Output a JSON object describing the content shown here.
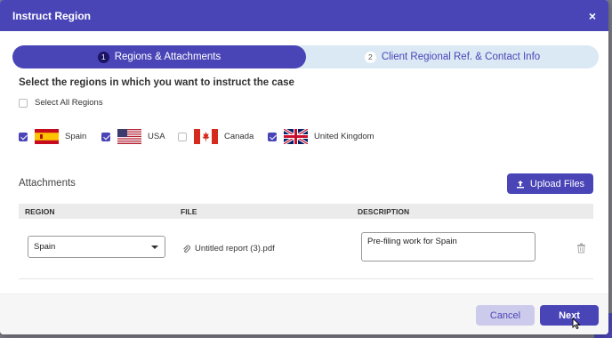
{
  "modal": {
    "title": "Instruct Region",
    "close_symbol": "×"
  },
  "steps": [
    {
      "number": "1",
      "label": "Regions & Attachments",
      "active": true
    },
    {
      "number": "2",
      "label": "Client Regional Ref. & Contact Info",
      "active": false
    }
  ],
  "regions_section": {
    "heading": "Select the regions in which you want to instruct the case",
    "select_all_label": "Select All Regions",
    "select_all_checked": false,
    "regions": [
      {
        "name": "Spain",
        "checked": true,
        "flag": "spain-flag-icon"
      },
      {
        "name": "USA",
        "checked": true,
        "flag": "usa-flag-icon"
      },
      {
        "name": "Canada",
        "checked": false,
        "flag": "canada-flag-icon"
      },
      {
        "name": "United Kingdom",
        "checked": true,
        "flag": "uk-flag-icon"
      }
    ]
  },
  "attachments": {
    "label": "Attachments",
    "upload_label": "Upload Files",
    "columns": [
      "REGION",
      "FILE",
      "DESCRIPTION"
    ],
    "rows": [
      {
        "region": "Spain",
        "file": "Untitled report (3).pdf",
        "description": "Pre-filing work for Spain"
      }
    ]
  },
  "footer": {
    "cancel_label": "Cancel",
    "next_label": "Next"
  },
  "colors": {
    "primary": "#4a45b7",
    "step_track": "#dbe9f5",
    "cancel_bg": "#cdcbeb"
  }
}
